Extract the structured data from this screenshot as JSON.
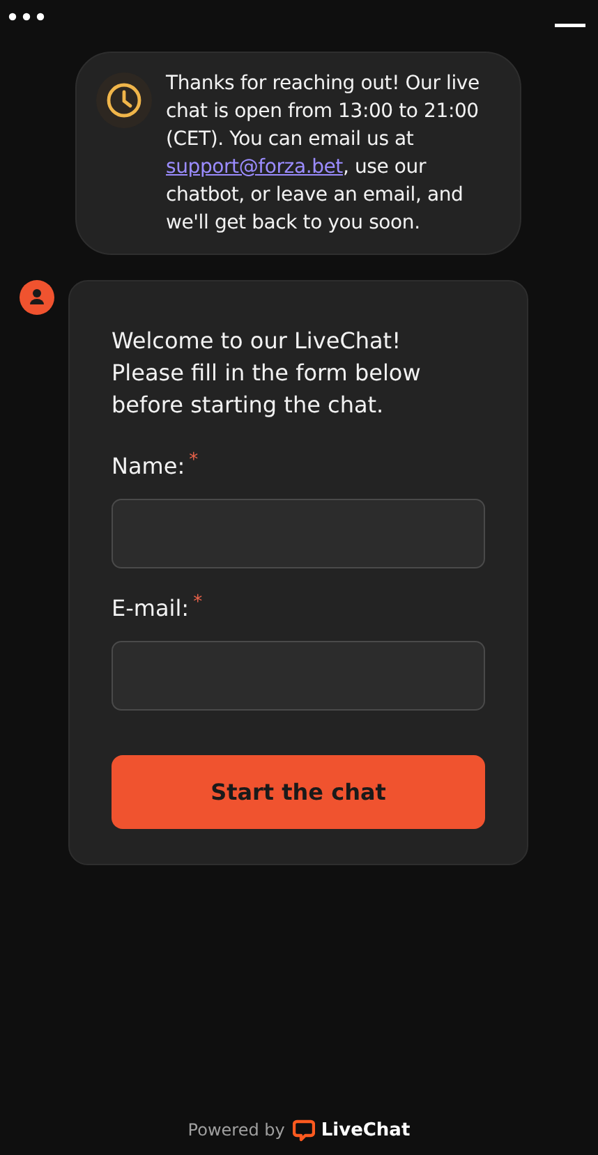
{
  "message": {
    "text_before": "Thanks for reaching out! Our live chat is open from 13:00 to 21:00 (CET). You can email us at ",
    "link": "support@forza.bet",
    "text_after": ", use our chatbot, or leave an email, and we'll get back to you soon."
  },
  "form": {
    "intro": "Welcome to our LiveChat! Please fill in the form below before starting the chat.",
    "fields": [
      {
        "label": "Name:",
        "required_mark": "*"
      },
      {
        "label": "E-mail:",
        "required_mark": "*"
      }
    ],
    "submit": "Start the chat"
  },
  "footer": {
    "powered_by": "Powered by",
    "brand": "LiveChat"
  }
}
